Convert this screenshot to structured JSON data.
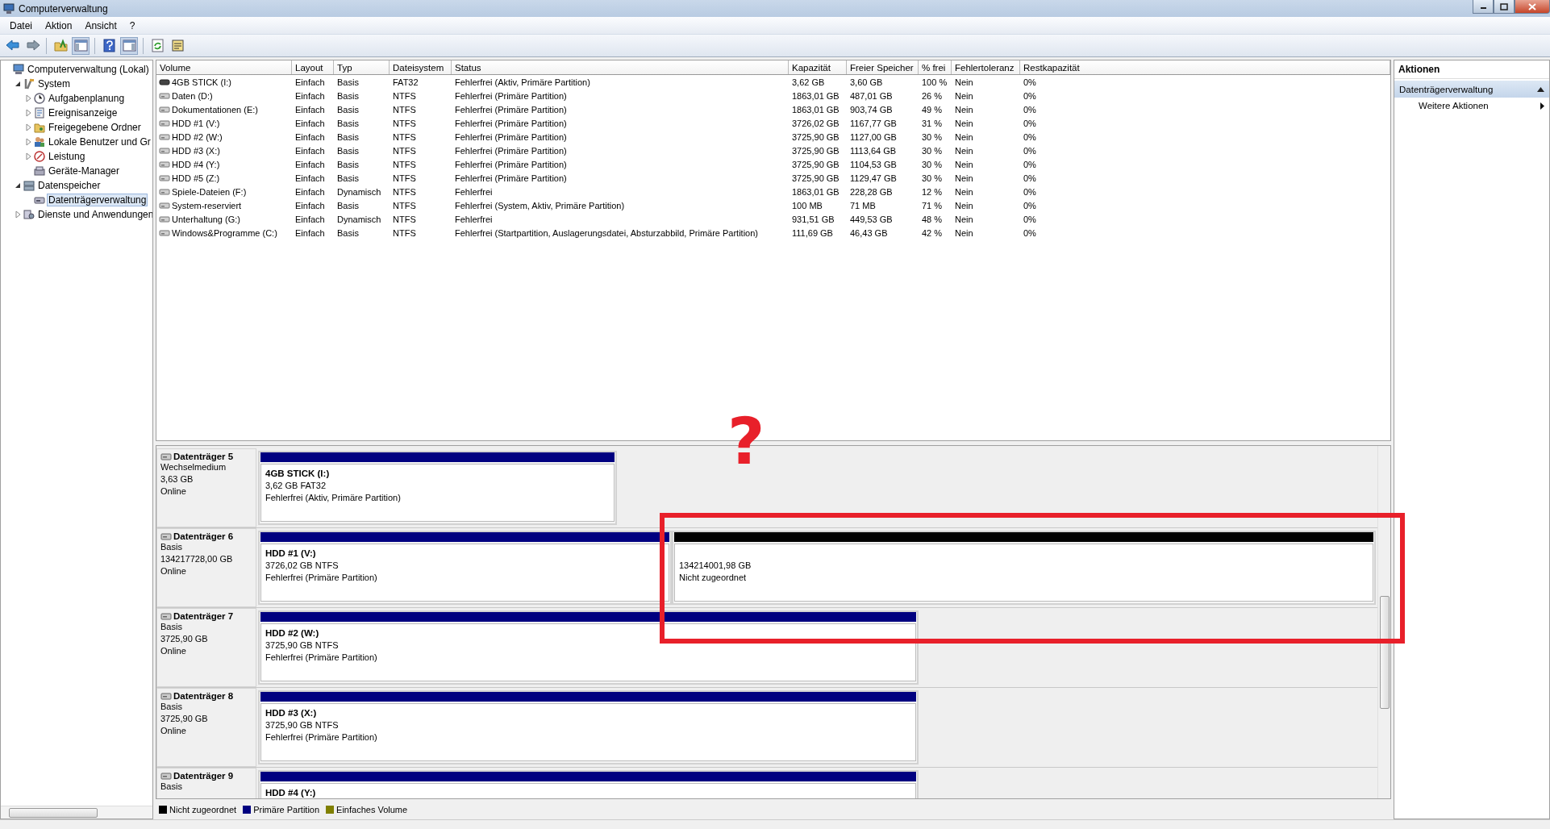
{
  "window": {
    "title": "Computerverwaltung"
  },
  "menu": [
    "Datei",
    "Aktion",
    "Ansicht",
    "?"
  ],
  "tree": [
    {
      "label": "Computerverwaltung (Lokal)",
      "selected": false,
      "children": [
        {
          "label": "System",
          "expanded": true,
          "selected": false,
          "children": [
            {
              "label": "Aufgabenplanung",
              "expanded": false,
              "selected": false
            },
            {
              "label": "Ereignisanzeige",
              "expanded": false,
              "selected": false
            },
            {
              "label": "Freigegebene Ordner",
              "expanded": false,
              "selected": false
            },
            {
              "label": "Lokale Benutzer und Gr",
              "expanded": false,
              "selected": false
            },
            {
              "label": "Leistung",
              "expanded": false,
              "selected": false
            },
            {
              "label": "Geräte-Manager",
              "selected": false
            }
          ]
        },
        {
          "label": "Datenspeicher",
          "expanded": true,
          "selected": false,
          "children": [
            {
              "label": "Datenträgerverwaltung",
              "selected": true
            }
          ]
        },
        {
          "label": "Dienste und Anwendungen",
          "expanded": false,
          "selected": false
        }
      ]
    }
  ],
  "table": {
    "columns": [
      "Volume",
      "Layout",
      "Typ",
      "Dateisystem",
      "Status",
      "Kapazität",
      "Freier Speicher",
      "% frei",
      "Fehlertoleranz",
      "Restkapazität"
    ],
    "rows": [
      [
        "4GB STICK (I:)",
        "Einfach",
        "Basis",
        "FAT32",
        "Fehlerfrei (Aktiv, Primäre Partition)",
        "3,62 GB",
        "3,60 GB",
        "100 %",
        "Nein",
        "0%"
      ],
      [
        "Daten (D:)",
        "Einfach",
        "Basis",
        "NTFS",
        "Fehlerfrei (Primäre Partition)",
        "1863,01 GB",
        "487,01 GB",
        "26 %",
        "Nein",
        "0%"
      ],
      [
        "Dokumentationen (E:)",
        "Einfach",
        "Basis",
        "NTFS",
        "Fehlerfrei (Primäre Partition)",
        "1863,01 GB",
        "903,74 GB",
        "49 %",
        "Nein",
        "0%"
      ],
      [
        "HDD #1 (V:)",
        "Einfach",
        "Basis",
        "NTFS",
        "Fehlerfrei (Primäre Partition)",
        "3726,02 GB",
        "1167,77 GB",
        "31 %",
        "Nein",
        "0%"
      ],
      [
        "HDD #2 (W:)",
        "Einfach",
        "Basis",
        "NTFS",
        "Fehlerfrei (Primäre Partition)",
        "3725,90 GB",
        "1127,00 GB",
        "30 %",
        "Nein",
        "0%"
      ],
      [
        "HDD #3 (X:)",
        "Einfach",
        "Basis",
        "NTFS",
        "Fehlerfrei (Primäre Partition)",
        "3725,90 GB",
        "1113,64 GB",
        "30 %",
        "Nein",
        "0%"
      ],
      [
        "HDD #4 (Y:)",
        "Einfach",
        "Basis",
        "NTFS",
        "Fehlerfrei (Primäre Partition)",
        "3725,90 GB",
        "1104,53 GB",
        "30 %",
        "Nein",
        "0%"
      ],
      [
        "HDD #5 (Z:)",
        "Einfach",
        "Basis",
        "NTFS",
        "Fehlerfrei (Primäre Partition)",
        "3725,90 GB",
        "1129,47 GB",
        "30 %",
        "Nein",
        "0%"
      ],
      [
        "Spiele-Dateien (F:)",
        "Einfach",
        "Dynamisch",
        "NTFS",
        "Fehlerfrei",
        "1863,01 GB",
        "228,28 GB",
        "12 %",
        "Nein",
        "0%"
      ],
      [
        "System-reserviert",
        "Einfach",
        "Basis",
        "NTFS",
        "Fehlerfrei (System, Aktiv, Primäre Partition)",
        "100 MB",
        "71 MB",
        "71 %",
        "Nein",
        "0%"
      ],
      [
        "Unterhaltung (G:)",
        "Einfach",
        "Dynamisch",
        "NTFS",
        "Fehlerfrei",
        "931,51 GB",
        "449,53 GB",
        "48 %",
        "Nein",
        "0%"
      ],
      [
        "Windows&Programme (C:)",
        "Einfach",
        "Basis",
        "NTFS",
        "Fehlerfrei (Startpartition, Auslagerungsdatei, Absturzabbild, Primäre Partition)",
        "111,69 GB",
        "46,43 GB",
        "42 %",
        "Nein",
        "0%"
      ]
    ]
  },
  "disks": [
    {
      "name": "Datenträger 5",
      "lines": [
        "Wechselmedium",
        "3,63 GB",
        "Online"
      ],
      "partitions": [
        {
          "kind": "primary",
          "name": "4GB STICK  (I:)",
          "lines": [
            "3,62 GB FAT32",
            "Fehlerfrei (Aktiv, Primäre Partition)"
          ]
        }
      ]
    },
    {
      "name": "Datenträger 6",
      "lines": [
        "Basis",
        "134217728,00 GB",
        "Online"
      ],
      "partitions": [
        {
          "kind": "primary",
          "name": "HDD #1  (V:)",
          "lines": [
            "3726,02 GB NTFS",
            "Fehlerfrei (Primäre Partition)"
          ]
        },
        {
          "kind": "unallocated",
          "lines": [
            "134214001,98 GB",
            "Nicht zugeordnet"
          ]
        }
      ]
    },
    {
      "name": "Datenträger 7",
      "lines": [
        "Basis",
        "3725,90 GB",
        "Online"
      ],
      "partitions": [
        {
          "kind": "primary",
          "name": "HDD #2  (W:)",
          "lines": [
            "3725,90 GB NTFS",
            "Fehlerfrei (Primäre Partition)"
          ]
        }
      ]
    },
    {
      "name": "Datenträger 8",
      "lines": [
        "Basis",
        "3725,90 GB",
        "Online"
      ],
      "partitions": [
        {
          "kind": "primary",
          "name": "HDD #3  (X:)",
          "lines": [
            "3725,90 GB NTFS",
            "Fehlerfrei (Primäre Partition)"
          ]
        }
      ]
    },
    {
      "name": "Datenträger 9",
      "lines": [
        "Basis"
      ],
      "partitions": [
        {
          "kind": "primary",
          "name": "HDD #4  (Y:)"
        }
      ]
    }
  ],
  "legend": [
    {
      "label": "Nicht zugeordnet",
      "color": "#000000"
    },
    {
      "label": "Primäre Partition",
      "color": "#000080"
    },
    {
      "label": "Einfaches Volume",
      "color": "#808000"
    }
  ],
  "actions": {
    "title": "Aktionen",
    "section": {
      "label": "Datenträgerverwaltung",
      "expanded": true
    },
    "items": [
      "Weitere Aktionen"
    ]
  },
  "annotation": {
    "mark": "?"
  }
}
